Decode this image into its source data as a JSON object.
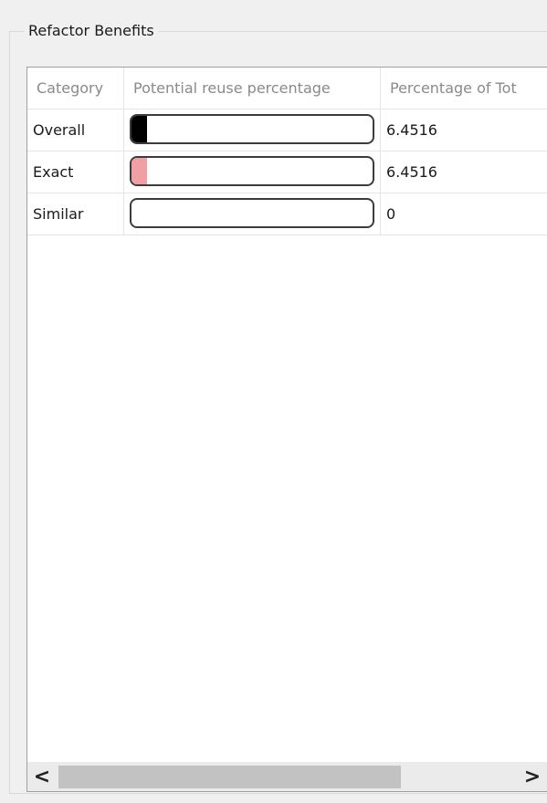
{
  "group": {
    "title": "Refactor Benefits"
  },
  "table": {
    "headers": [
      "Category",
      "Potential reuse percentage",
      "Percentage of Tot"
    ],
    "rows": [
      {
        "category": "Overall",
        "reuse_fraction": 0.0645,
        "bar_color": "#000000",
        "percentage": "6.4516"
      },
      {
        "category": "Exact",
        "reuse_fraction": 0.0645,
        "bar_color": "#f0a0a4",
        "percentage": "6.4516"
      },
      {
        "category": "Similar",
        "reuse_fraction": 0,
        "bar_color": "#f0a0a4",
        "percentage": "0"
      }
    ]
  },
  "scrollbar": {
    "left_icon": "chevron-left-icon",
    "right_icon": "chevron-right-icon",
    "left_glyph": "<",
    "right_glyph": ">"
  }
}
